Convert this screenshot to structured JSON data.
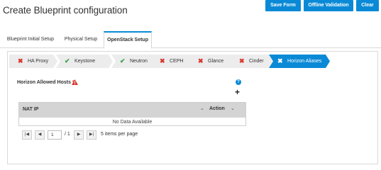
{
  "header": {
    "title": "Create Blueprint configuration",
    "buttons": {
      "save": "Save Form",
      "offline": "Offline Validation",
      "clear": "Clear"
    }
  },
  "tabs": [
    {
      "label": "Blueprint Initial Setup"
    },
    {
      "label": "Physical Setup"
    },
    {
      "label": "OpenStack Setup",
      "active": true
    }
  ],
  "steps": [
    {
      "label": "HA Proxy",
      "status": "error"
    },
    {
      "label": "Keystone",
      "status": "ok"
    },
    {
      "label": "Neutron",
      "status": "ok"
    },
    {
      "label": "CEPH",
      "status": "error"
    },
    {
      "label": "Glance",
      "status": "error"
    },
    {
      "label": "Cinder",
      "status": "error"
    },
    {
      "label": "Horizon Aliases",
      "status": "error",
      "active": true
    }
  ],
  "icons": {
    "error": "✖",
    "ok": "✔"
  },
  "section": {
    "label": "Horizon Allowed Hosts",
    "required_mark": "*",
    "help": "?",
    "add": "+"
  },
  "grid": {
    "columns": [
      "NAT IP",
      "Action"
    ],
    "empty_text": "No Data Available"
  },
  "pager": {
    "page": "1",
    "of_text": "/ 1",
    "items_per_page_text": "5 items per page"
  },
  "colors": {
    "accent": "#0a8ad6",
    "error": "#d9342b",
    "ok": "#3aa346"
  }
}
